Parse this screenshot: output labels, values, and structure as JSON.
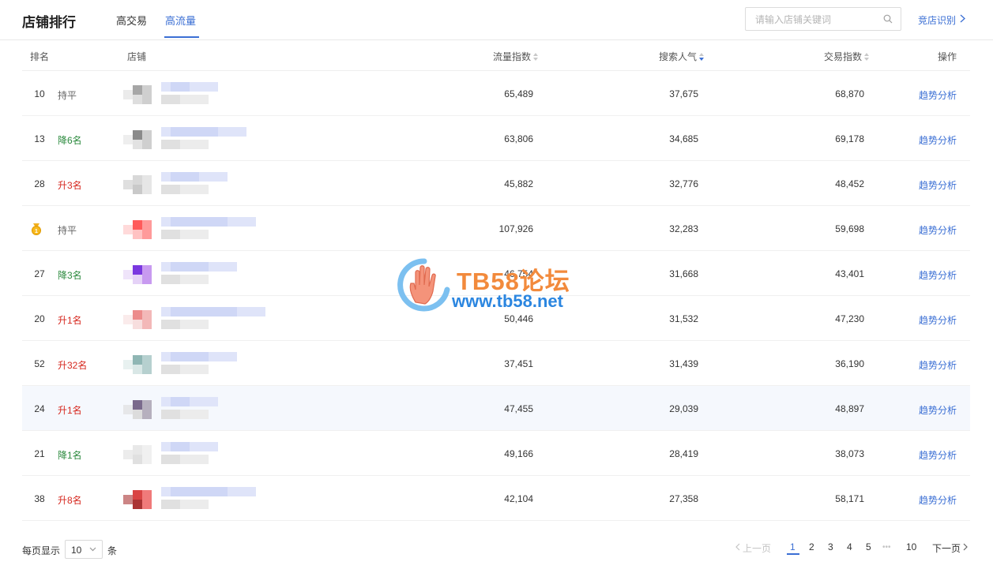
{
  "header": {
    "title": "店铺排行",
    "tabs": [
      {
        "label": "高交易",
        "active": false
      },
      {
        "label": "高流量",
        "active": true
      }
    ],
    "search_placeholder": "请输入店铺关键词",
    "compete_link": "竞店识别"
  },
  "table": {
    "columns": {
      "rank": "排名",
      "shop": "店铺",
      "flow": "流量指数",
      "search": "搜索人气",
      "trade": "交易指数",
      "action": "操作"
    },
    "sort_column": "search",
    "sort_direction": "desc",
    "rows": [
      {
        "rank": "10",
        "change": "持平",
        "trend": "flat",
        "flow": "65,489",
        "search": "37,675",
        "trade": "68,870",
        "action": "趋势分析"
      },
      {
        "rank": "13",
        "change": "降6名",
        "trend": "down",
        "flow": "63,806",
        "search": "34,685",
        "trade": "69,178",
        "action": "趋势分析"
      },
      {
        "rank": "28",
        "change": "升3名",
        "trend": "up",
        "flow": "45,882",
        "search": "32,776",
        "trade": "48,452",
        "action": "趋势分析"
      },
      {
        "rank": "",
        "medal": true,
        "change": "持平",
        "trend": "flat",
        "flow": "107,926",
        "search": "32,283",
        "trade": "59,698",
        "action": "趋势分析"
      },
      {
        "rank": "27",
        "change": "降3名",
        "trend": "down",
        "flow": "46,754",
        "search": "31,668",
        "trade": "43,401",
        "action": "趋势分析"
      },
      {
        "rank": "20",
        "change": "升1名",
        "trend": "up",
        "flow": "50,446",
        "search": "31,532",
        "trade": "47,230",
        "action": "趋势分析"
      },
      {
        "rank": "52",
        "change": "升32名",
        "trend": "up",
        "flow": "37,451",
        "search": "31,439",
        "trade": "36,190",
        "action": "趋势分析"
      },
      {
        "rank": "24",
        "change": "升1名",
        "trend": "up",
        "flow": "47,455",
        "search": "29,039",
        "trade": "48,897",
        "action": "趋势分析",
        "highlight": true
      },
      {
        "rank": "21",
        "change": "降1名",
        "trend": "down",
        "flow": "49,166",
        "search": "28,419",
        "trade": "38,073",
        "action": "趋势分析"
      },
      {
        "rank": "38",
        "change": "升8名",
        "trend": "up",
        "flow": "42,104",
        "search": "27,358",
        "trade": "58,171",
        "action": "趋势分析"
      }
    ]
  },
  "pagination": {
    "per_page_label": "每页显示",
    "per_page_value": "10",
    "per_page_suffix": "条",
    "prev": "上一页",
    "pages": [
      "1",
      "2",
      "3",
      "4",
      "5"
    ],
    "ellipsis": "•••",
    "last": "10",
    "next": "下一页",
    "current": "1"
  },
  "watermark": {
    "title": "TB58论坛",
    "url": "www.tb58.net"
  },
  "colors": {
    "accent": "#3b6fd4",
    "up": "#d6281f",
    "down": "#2b8a3e",
    "flat": "#666666",
    "watermark_orange": "#f28a3c",
    "watermark_blue": "#2b86e0"
  },
  "icons": {
    "search": "search-icon",
    "chevron_right": "chevron-right-icon",
    "chevron_left": "chevron-left-icon",
    "chevron_down": "chevron-down-icon",
    "medal": "gold-medal-icon",
    "sort": "sort-icon",
    "watermark_logo": "hand-logo-icon"
  }
}
